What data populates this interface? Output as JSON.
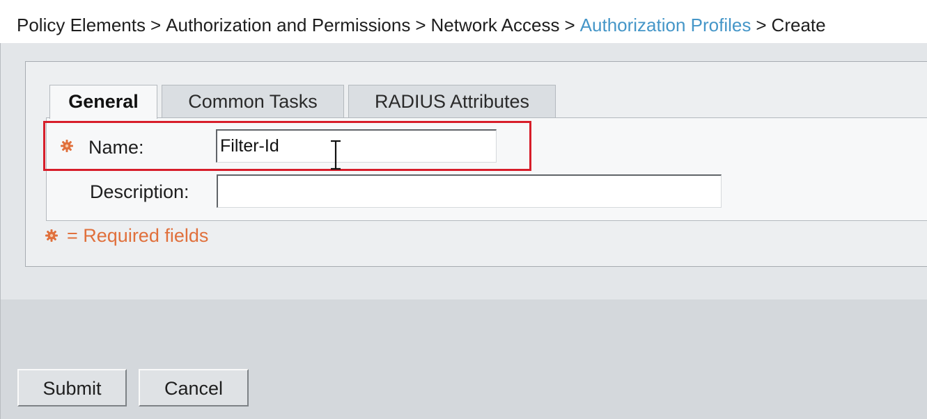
{
  "breadcrumb": {
    "items": [
      {
        "label": "Policy Elements"
      },
      {
        "label": "Authorization and Permissions"
      },
      {
        "label": "Network Access"
      },
      {
        "label": "Authorization Profiles"
      },
      {
        "label": "Create"
      }
    ],
    "separator": ">"
  },
  "tabs": [
    {
      "label": "General",
      "active": true
    },
    {
      "label": "Common Tasks",
      "active": false
    },
    {
      "label": "RADIUS Attributes",
      "active": false
    }
  ],
  "form": {
    "name_label": "Name:",
    "name_value": "Filter-Id",
    "description_label": "Description:",
    "description_value": ""
  },
  "required_note": {
    "text": "= Required fields"
  },
  "buttons": {
    "submit_label": "Submit",
    "cancel_label": "Cancel"
  },
  "colors": {
    "link": "#4596c8",
    "required_accent": "#e0703c",
    "highlight": "#d71e2a"
  },
  "icons": {
    "required_marker": "required-asterisk-icon",
    "cursor": "text-cursor-icon"
  }
}
